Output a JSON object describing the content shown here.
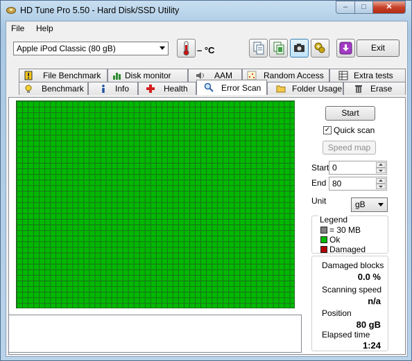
{
  "window": {
    "title": "HD Tune Pro 5.50 - Hard Disk/SSD Utility"
  },
  "menu": {
    "file": "File",
    "help": "Help"
  },
  "toolbar": {
    "drive": "Apple   iPod Classic (80 gB)",
    "temperature": "– °C",
    "exit_label": "Exit",
    "icons": [
      "thermometer-icon",
      "copy-text-icon",
      "copy-info-icon",
      "screenshot-icon",
      "options-icon",
      "save-icon"
    ]
  },
  "tabs": {
    "row1": [
      "File Benchmark",
      "Disk monitor",
      "AAM",
      "Random Access",
      "Extra tests"
    ],
    "row2": [
      "Benchmark",
      "Info",
      "Health",
      "Error Scan",
      "Folder Usage",
      "Erase"
    ],
    "selected": "Error Scan"
  },
  "scan": {
    "start_label": "Start",
    "quick_scan_label": "Quick scan",
    "quick_scan_checked": true,
    "speed_map_label": "Speed map",
    "start_field_label": "Start",
    "start_value": "0",
    "end_field_label": "End",
    "end_value": "80",
    "unit_label": "Unit",
    "unit_value": "gB",
    "block_color": "#00b900"
  },
  "legend": {
    "title": "Legend",
    "block_size": "= 30 MB",
    "ok": "Ok",
    "damaged": "Damaged",
    "colors": {
      "block": "#808080",
      "ok": "#00b900",
      "damaged": "#b00000"
    }
  },
  "stats": {
    "damaged_blocks_label": "Damaged blocks",
    "damaged_blocks_value": "0.0 %",
    "scanning_speed_label": "Scanning speed",
    "scanning_speed_value": "n/a",
    "position_label": "Position",
    "position_value": "80 gB",
    "elapsed_label": "Elapsed time",
    "elapsed_value": "1:24"
  }
}
